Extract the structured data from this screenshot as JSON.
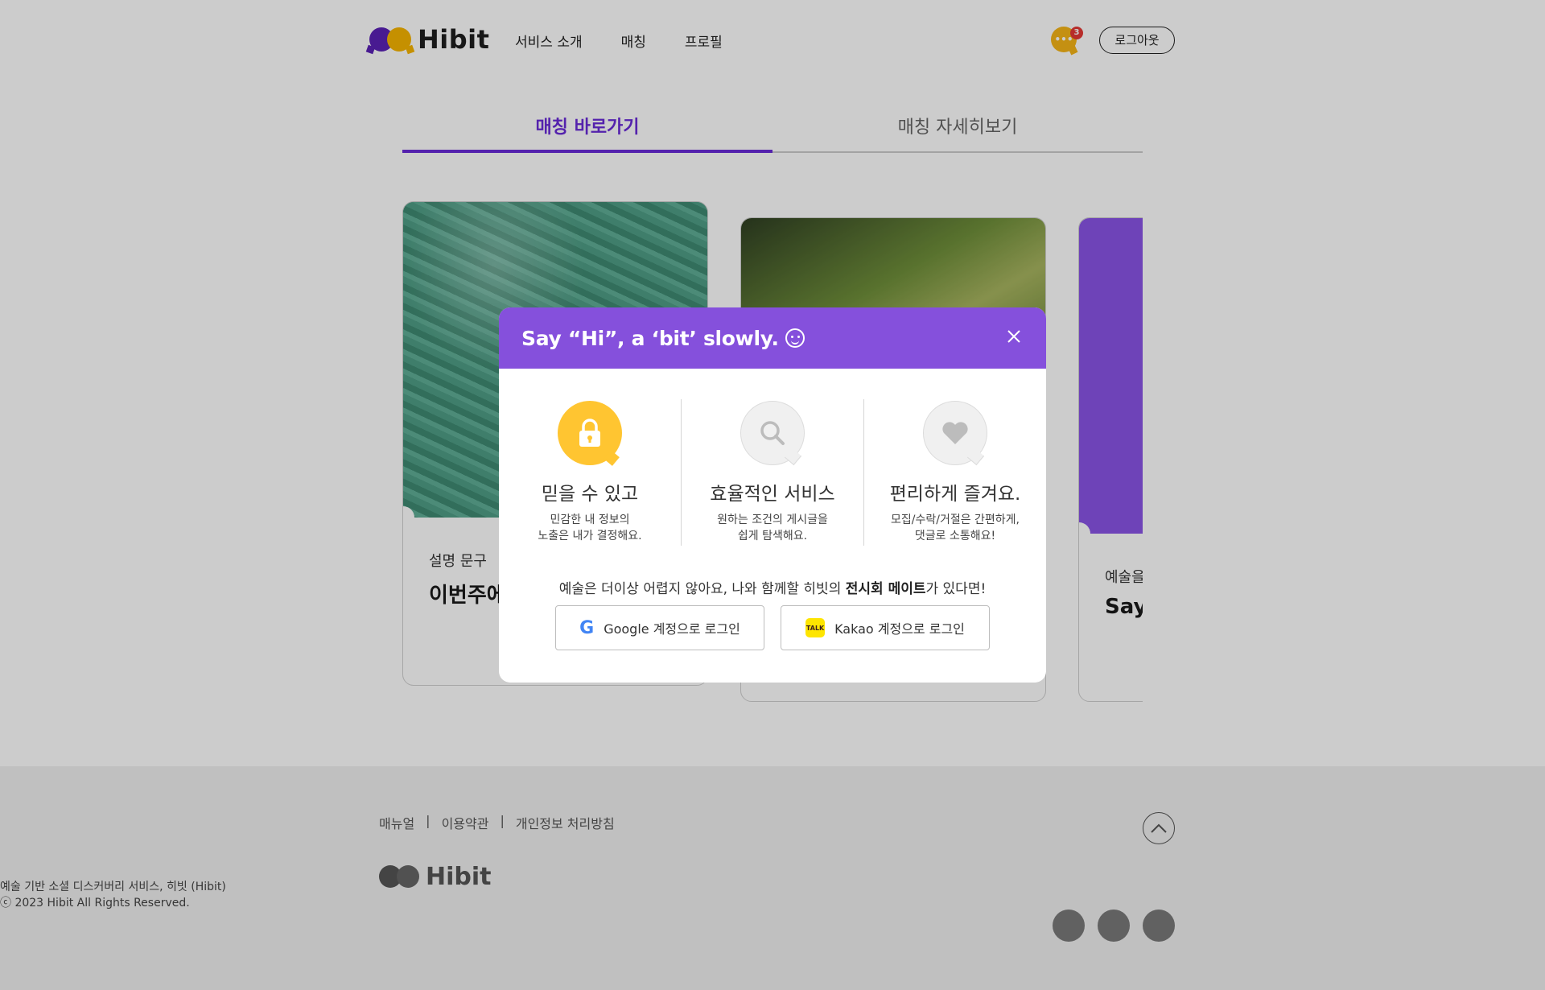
{
  "header": {
    "logo_text": "Hibit",
    "nav": [
      "서비스 소개",
      "매칭",
      "프로필"
    ],
    "chat_badge": "3",
    "logout_label": "로그아웃"
  },
  "tabs": [
    {
      "label": "매칭 바로가기",
      "active": true
    },
    {
      "label": "매칭 자세히보기",
      "active": false
    }
  ],
  "cards": [
    {
      "caption": "설명 문구",
      "title": "이번주에"
    },
    {
      "caption": "",
      "title": ""
    },
    {
      "caption": "예술을",
      "title": "Say"
    }
  ],
  "modal": {
    "title": "Say “Hi”, a ‘bit’ slowly.",
    "close_icon": "close-icon",
    "features": [
      {
        "icon": "lock-icon",
        "name": "믿을 수 있고",
        "desc": [
          "민감한 내 정보의",
          "노출은 내가 결정해요."
        ]
      },
      {
        "icon": "search-icon",
        "name": "효율적인 서비스",
        "desc": [
          "원하는 조건의 게시글을",
          "쉽게 탐색해요."
        ]
      },
      {
        "icon": "heart-icon",
        "name": "편리하게 즐겨요.",
        "desc": [
          "모집/수락/거절은 간편하게,",
          "댓글로 소통해요!"
        ]
      }
    ],
    "tagline_pre": "예술은 더이상 어렵지 않아요, 나와 함께할 히빗의 ",
    "tagline_bold": "전시회 메이트",
    "tagline_post": "가 있다면!",
    "google_label": "Google 계정으로 로그인",
    "kakao_label": "Kakao 계정으로 로그인",
    "kakao_icon_text": "TALK"
  },
  "footer": {
    "links": [
      "매뉴얼",
      "이용약관",
      "개인정보 처리방침"
    ],
    "separator": "|",
    "logo_text": "Hibit",
    "desc_line1": "예술 기반 소셜 디스커버리 서비스, 히빗 (Hibit)",
    "desc_line2": "ⓒ 2023 Hibit All Rights Reserved."
  },
  "colors": {
    "brand_purple": "#8550dc",
    "brand_yellow": "#f7b500",
    "overlay": "rgba(0,0,0,0.2)"
  }
}
